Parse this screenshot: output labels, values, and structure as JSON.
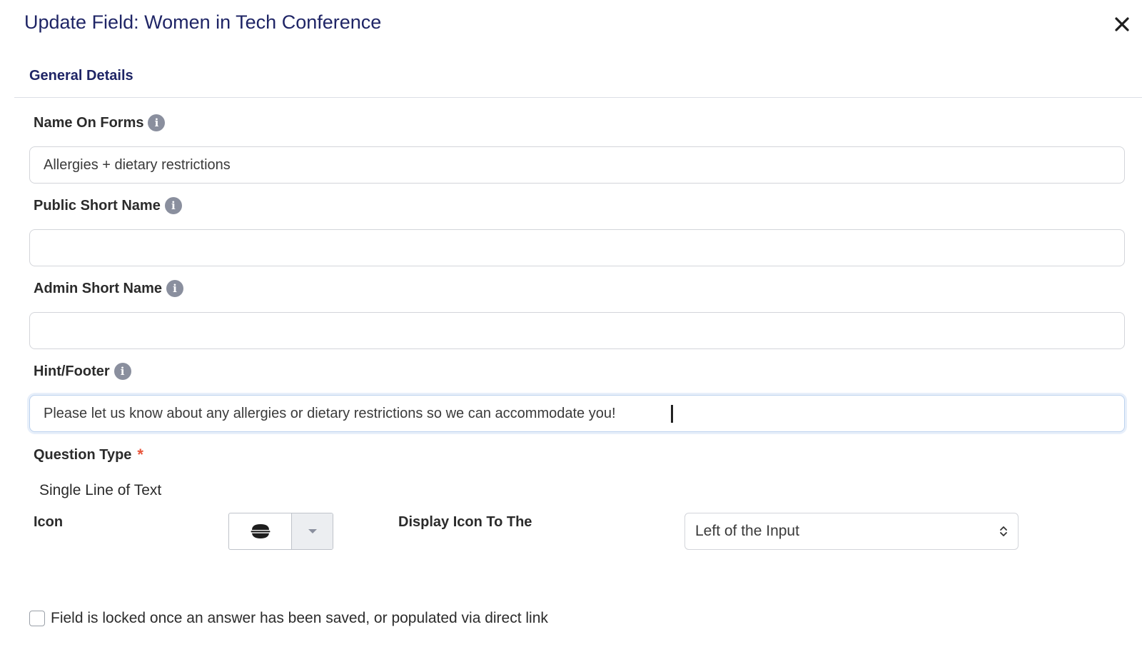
{
  "modal": {
    "title": "Update Field: Women in Tech Conference"
  },
  "tabs": [
    {
      "label": "General Details"
    }
  ],
  "fields": {
    "name_on_forms": {
      "label": "Name On Forms",
      "value": "Allergies + dietary restrictions"
    },
    "public_short_name": {
      "label": "Public Short Name",
      "value": ""
    },
    "admin_short_name": {
      "label": "Admin Short Name",
      "value": ""
    },
    "hint_footer": {
      "label": "Hint/Footer",
      "value": "Please let us know about any allergies or dietary restrictions so we can accommodate you!"
    },
    "question_type": {
      "label": "Question Type",
      "required_marker": "*",
      "value": "Single Line of Text"
    },
    "icon": {
      "label": "Icon",
      "selected_icon": "bowl-food-icon"
    },
    "display_icon": {
      "label": "Display Icon To The",
      "selected": "Left of the Input"
    },
    "locked": {
      "label": "Field is locked once an answer has been saved, or populated via direct link",
      "checked": false
    }
  },
  "icons": {
    "info": "i",
    "close": "close-icon",
    "info_name": "info-icon"
  },
  "colors": {
    "title": "#1f2566",
    "info_badge": "#8a8f9e",
    "required": "#e8553b"
  }
}
